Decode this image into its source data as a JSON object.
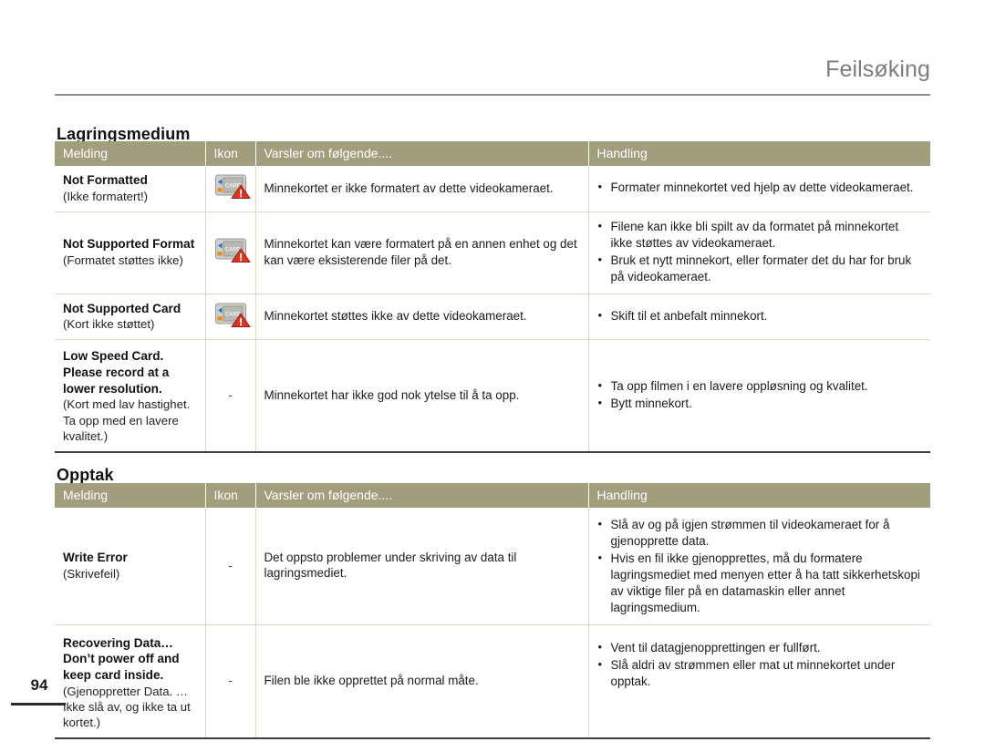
{
  "page": {
    "running_head": "Feilsøking",
    "folio": "94"
  },
  "sections": [
    {
      "id": "storage",
      "title": "Lagringsmedium",
      "columns": [
        "Melding",
        "Ikon",
        "Varsler om følgende....",
        "Handling"
      ],
      "rows": [
        {
          "message_en": "Not Formatted",
          "message_no": "(Ikke formatert!)",
          "icon": "memory-card-warning-icon",
          "warning": "Minnekortet er ikke formatert av dette videokameraet.",
          "actions": [
            "Formater minnekortet ved hjelp av dette videokameraet."
          ]
        },
        {
          "message_en": "Not Supported Format",
          "message_no": "(Formatet støttes ikke)",
          "icon": "memory-card-warning-icon",
          "warning": "Minnekortet kan være formatert på en annen enhet og det kan være eksisterende filer på det.",
          "actions": [
            "Filene kan ikke bli spilt av da formatet på minnekortet ikke støttes av videokameraet.",
            "Bruk et nytt minnekort, eller formater det du har for bruk på videokameraet."
          ]
        },
        {
          "message_en": "Not Supported Card",
          "message_no": "(Kort ikke støttet)",
          "icon": "memory-card-warning-icon",
          "warning": "Minnekortet støttes ikke av dette videokameraet.",
          "actions": [
            "Skift til et anbefalt minnekort."
          ]
        },
        {
          "message_en": "Low Speed Card. Please record at a lower resolution.",
          "message_no": "(Kort med lav hastighet. Ta opp med en lavere kvalitet.)",
          "icon": "dash",
          "warning": "Minnekortet har ikke god nok ytelse til å ta opp.",
          "actions": [
            "Ta opp filmen i en lavere oppløsning og kvalitet.",
            "Bytt minnekort."
          ]
        }
      ]
    },
    {
      "id": "record",
      "title": "Opptak",
      "columns": [
        "Melding",
        "Ikon",
        "Varsler om følgende....",
        "Handling"
      ],
      "rows": [
        {
          "message_en": "Write Error",
          "message_no": "(Skrivefeil)",
          "icon": "dash",
          "warning": "Det oppsto problemer under skriving av data til lagringsmediet.",
          "actions": [
            "Slå av og på igjen strømmen til videokameraet for å gjenopprette data.",
            "Hvis en fil ikke gjenopprettes, må du formatere lagringsmediet med menyen etter å ha tatt sikkerhetskopi av viktige filer på en datamaskin eller annet lagringsmedium."
          ]
        },
        {
          "message_en": "Recovering Data… Don’t power off and keep card inside.",
          "message_no": "(Gjenoppretter Data. … Ikke slå av, og ikke ta ut kortet.)",
          "icon": "dash",
          "warning": "Filen ble ikke opprettet på normal måte.",
          "actions": [
            "Vent til datagjenopprettingen er fullført.",
            "Slå aldri av strømmen eller mat ut minnekortet under opptak."
          ]
        }
      ]
    }
  ],
  "icon_labels": {
    "memory_card": "CARD",
    "dash": "-"
  },
  "colors": {
    "table_header_bg": "#a19e7e",
    "table_header_text": "#ffffff",
    "running_head": "#7c7c7c",
    "row_divider": "#dcd9c4",
    "table_bottom_rule": "#3d3d3d",
    "warning_triangle": "#e03020"
  }
}
